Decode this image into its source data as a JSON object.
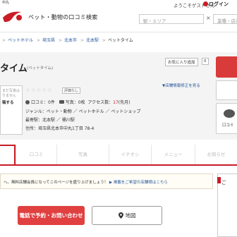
{
  "header": {
    "logo_caption": "中丸",
    "site_title": "ペット・動物の口コミ検索",
    "welcome": "ようこそゲストさん",
    "login_label": "ログイン",
    "search_area_placeholder": "駅・エリア",
    "search_keyword_placeholder": "業種・店名",
    "search_separator": "×"
  },
  "breadcrumb": {
    "items": [
      "ペットホテル",
      "埼玉県",
      "北本市",
      "北本駅"
    ],
    "current": "ペットタイム",
    "separator": ">"
  },
  "shop": {
    "name": "タイム",
    "kana": "(ペットタイム)",
    "fav_label": "お気に入り追加",
    "fav_count": "0",
    "stars": "☆☆☆☆☆",
    "rating_text": "評価なし",
    "edit_link": "▼店舗情報修正を見る",
    "photo_box": {
      "line1": "まだ写真は",
      "line2": "りません",
      "line3": "稿する"
    },
    "reviews_label": "口コミ：",
    "reviews_count": "0件",
    "photos_label": "写真：",
    "photos_count": "0枚",
    "access_label": "アクセス数：",
    "access_count": "17",
    "access_unit": "(先月)",
    "genre": "ジャンル：ペット・動物 ／ ペットホテル ／ ペットショップ",
    "station": "最寄駅：北本駅 ／ 桶川駅",
    "address": "住所：埼玉県北本市中丸1丁目 78-4",
    "side_label": "口コミ"
  },
  "tabs": [
    {
      "label": "",
      "active": true
    },
    {
      "label": "口コミ",
      "active": false
    },
    {
      "label": "写真",
      "active": false
    },
    {
      "label": "イチオシ",
      "active": false
    },
    {
      "label": "メニュー",
      "active": false
    },
    {
      "label": "お知らせ",
      "active": false
    }
  ],
  "notice": {
    "text": "へ。無料店舗会員になってこのページを盛り上げましょう！",
    "link": "▶ 掲載をご希望の店舗様はこちら"
  },
  "right_box": {
    "title": "ご"
  },
  "buttons": {
    "reserve": "電話で予約・お問い合わせ",
    "map": "地図"
  },
  "colors": {
    "brand_red": "#c91d26",
    "link_blue": "#2a5a9e",
    "button_red": "#e04040"
  }
}
